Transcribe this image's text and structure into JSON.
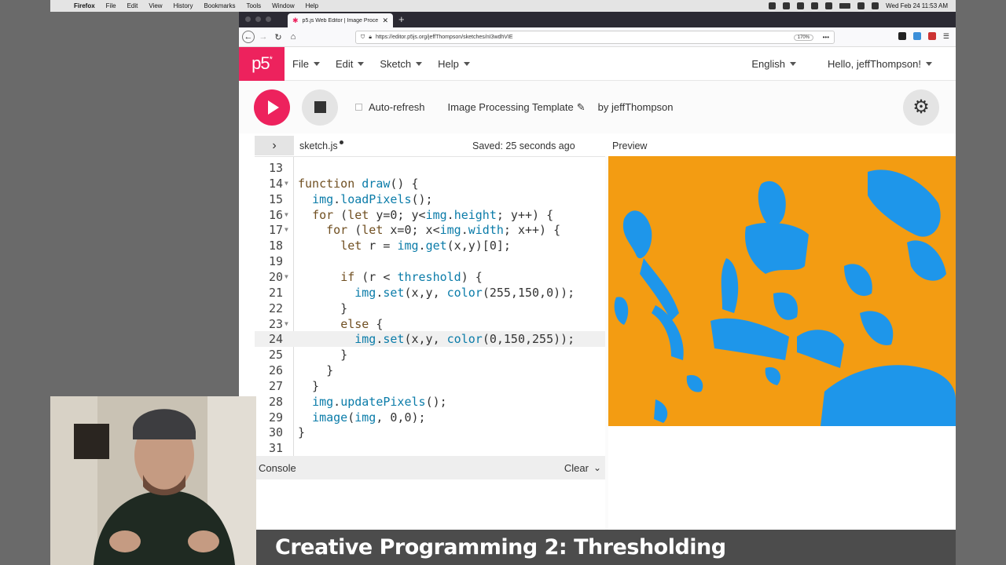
{
  "mac_menubar": {
    "items": [
      "Firefox",
      "File",
      "Edit",
      "View",
      "History",
      "Bookmarks",
      "Tools",
      "Window",
      "Help"
    ],
    "clock": "Wed Feb 24  11:53 AM"
  },
  "browser": {
    "tab_title": "p5.js Web Editor | Image Proce",
    "url": "https://editor.p5js.org/jeffThompson/sketches/nI3wdhVIE",
    "zoom": "170%"
  },
  "p5": {
    "logo": "p5",
    "menu": [
      "File",
      "Edit",
      "Sketch",
      "Help"
    ],
    "language": "English",
    "greeting": "Hello, jeffThompson!",
    "auto_refresh_label": "Auto-refresh",
    "sketch_name": "Image Processing Template",
    "author": "by jeffThompson",
    "file_name": "sketch.js",
    "saved_status": "Saved: 25 seconds ago",
    "preview_label": "Preview",
    "console_label": "Console",
    "clear_label": "Clear"
  },
  "code_lines": [
    {
      "n": "13",
      "text": ""
    },
    {
      "n": "14",
      "text": "function draw() {"
    },
    {
      "n": "15",
      "text": "  img.loadPixels();"
    },
    {
      "n": "16",
      "text": "  for (let y=0; y<img.height; y++) {"
    },
    {
      "n": "17",
      "text": "    for (let x=0; x<img.width; x++) {"
    },
    {
      "n": "18",
      "text": "      let r = img.get(x,y)[0];"
    },
    {
      "n": "19",
      "text": ""
    },
    {
      "n": "20",
      "text": "      if (r < threshold) {"
    },
    {
      "n": "21",
      "text": "        img.set(x,y, color(255,150,0));"
    },
    {
      "n": "22",
      "text": "      }"
    },
    {
      "n": "23",
      "text": "      else {"
    },
    {
      "n": "24",
      "text": "        img.set(x,y, color(0,150,255));"
    },
    {
      "n": "25",
      "text": "      }"
    },
    {
      "n": "26",
      "text": "    }"
    },
    {
      "n": "27",
      "text": "  }"
    },
    {
      "n": "28",
      "text": "  img.updatePixels();"
    },
    {
      "n": "29",
      "text": "  image(img, 0,0);"
    },
    {
      "n": "30",
      "text": "}"
    },
    {
      "n": "31",
      "text": ""
    }
  ],
  "caption": "Creative Programming 2: Thresholding",
  "colors": {
    "accent": "#ed225d",
    "preview_bg": "#f39c12",
    "preview_fg": "#1e96ea"
  }
}
